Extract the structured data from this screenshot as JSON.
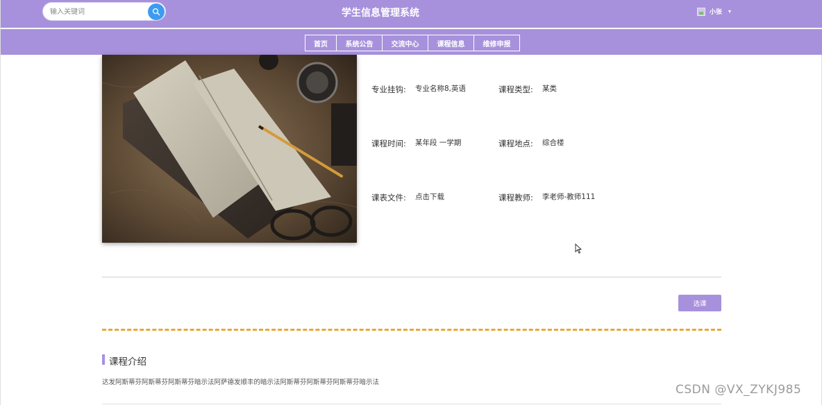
{
  "header": {
    "title": "学生信息管理系统",
    "search": {
      "placeholder": "输入关键词",
      "value": ""
    },
    "user": {
      "name": "小张"
    }
  },
  "nav": {
    "items": [
      {
        "label": "首页"
      },
      {
        "label": "系统公告"
      },
      {
        "label": "交流中心"
      },
      {
        "label": "课程信息"
      },
      {
        "label": "维修申报"
      }
    ]
  },
  "course": {
    "fields": [
      {
        "label": "专业挂钩:",
        "value": "专业名称8,英语"
      },
      {
        "label": "课程类型:",
        "value": "某类"
      },
      {
        "label": "课程时间:",
        "value": "某年段 一学期"
      },
      {
        "label": "课程地点:",
        "value": "综合楼"
      },
      {
        "label": "课表文件:",
        "value": "点击下载"
      },
      {
        "label": "课程教师:",
        "value": "李老师-教师111"
      }
    ],
    "choose_label": "选课"
  },
  "intro": {
    "title": "课程介绍",
    "text": "达发阿斯蒂芬阿斯蒂芬阿斯蒂芬暗示法阿萨德发顺丰的暗示法阿斯蒂芬阿斯蒂芬阿斯蒂芬暗示法"
  },
  "watermark": "CSDN @VX_ZYKJ985",
  "colors": {
    "theme": "#a791dc",
    "search_button": "#3e9bf0",
    "dashed_divider": "#e7a83a"
  }
}
